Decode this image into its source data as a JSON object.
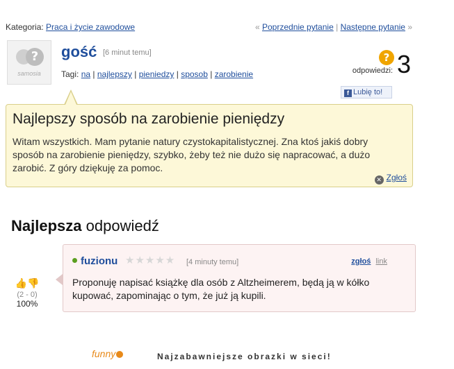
{
  "category": {
    "label": "Kategoria:",
    "value": "Praca i życie zawodowe"
  },
  "navigation": {
    "prev_arrow": "«",
    "prev": "Poprzednie pytanie",
    "separator": "|",
    "next": "Następne pytanie",
    "next_arrow": "»"
  },
  "question": {
    "author": "gość",
    "time": "[6 minut temu]",
    "avatar_logo": "samosia",
    "tags_label": "Tagi:",
    "tags": [
      "na",
      "najlepszy",
      "pieniedzy",
      "sposob",
      "zarobienie"
    ],
    "answers_label": "odpowiedzi:",
    "answers_count": "3",
    "answers_icon": "?",
    "like_label": "Lubię to!",
    "like_icon": "f",
    "title": "Najlepszy sposób na zarobienie pieniędzy",
    "body": "Witam wszystkich. Mam pytanie natury czystokapitalistycznej. Zna ktoś jakiś dobry sposób na zarobienie pieniędzy, szybko, żeby też nie dużo się napracować, a dużo zarobić. Z góry dziękuję za pomoc.",
    "report_label": "Zgłoś"
  },
  "best_answer": {
    "heading_bold": "Najlepsza",
    "heading_rest": "odpowiedź",
    "author": "fuzionu",
    "stars": "★★★★★",
    "time": "[4 minuty temu]",
    "report_label": "zgłoś",
    "link_label": "link",
    "text": "Proponuję napisać książkę dla osób z Altzheimerem, będą ją w kółko kupować, zapominając o tym, że już ją kupili.",
    "votes": "(2 - 0)",
    "percent": "100%"
  },
  "footer": {
    "logo": "funny",
    "tagline": "Najzabawniejsze obrazki w sieci!"
  },
  "colors": {
    "link": "#1f4e9c",
    "question_bg": "#fdf8d8",
    "answer_bg": "#fdf3f3",
    "answers_badge": "#f0a500"
  }
}
